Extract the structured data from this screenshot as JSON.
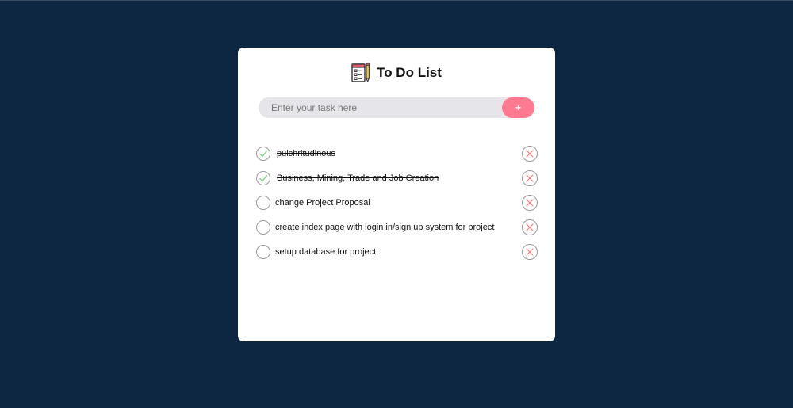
{
  "app": {
    "title": "To Do List",
    "logo_icon": "notepad-pencil-icon"
  },
  "input": {
    "placeholder": "Enter your task here",
    "value": "",
    "add_label": "+"
  },
  "colors": {
    "background": "#0d2742",
    "card": "#ffffff",
    "accent": "#ff7a90",
    "check": "#7ed67e",
    "delete": "#ff7a7a"
  },
  "tasks": [
    {
      "label": "pulchritudinous",
      "done": true
    },
    {
      "label": "Business, Mining, Trade and Job Creation",
      "done": true
    },
    {
      "label": "change Project Proposal",
      "done": false
    },
    {
      "label": "create index page with login in/sign up system for project",
      "done": false
    },
    {
      "label": "setup database for project",
      "done": false
    }
  ]
}
